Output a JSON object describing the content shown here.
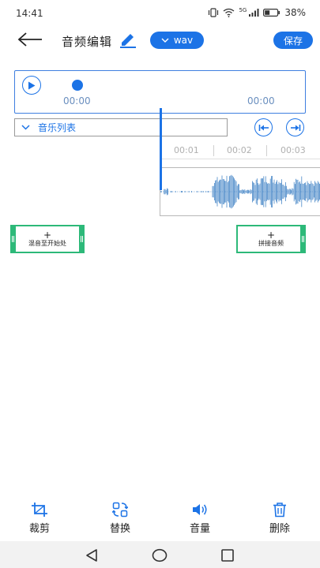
{
  "status": {
    "time": "14:41",
    "battery": "38%",
    "network": "5G"
  },
  "header": {
    "title": "音频编辑",
    "format": "wav",
    "save_label": "保存"
  },
  "player": {
    "current_time": "00:00",
    "total_time": "00:00",
    "progress": 0
  },
  "music_list": {
    "label": "音乐列表"
  },
  "timeline": {
    "ticks": [
      "00:01",
      "00:02",
      "00:03"
    ]
  },
  "clips": {
    "mix_label": "混音至开始处",
    "join_label": "拼接音频"
  },
  "toolbar": {
    "crop": "裁剪",
    "replace": "替换",
    "volume": "音量",
    "delete": "删除"
  },
  "colors": {
    "accent": "#1c73e6",
    "clip_green": "#2db979",
    "waveform": "#4a88c8"
  }
}
